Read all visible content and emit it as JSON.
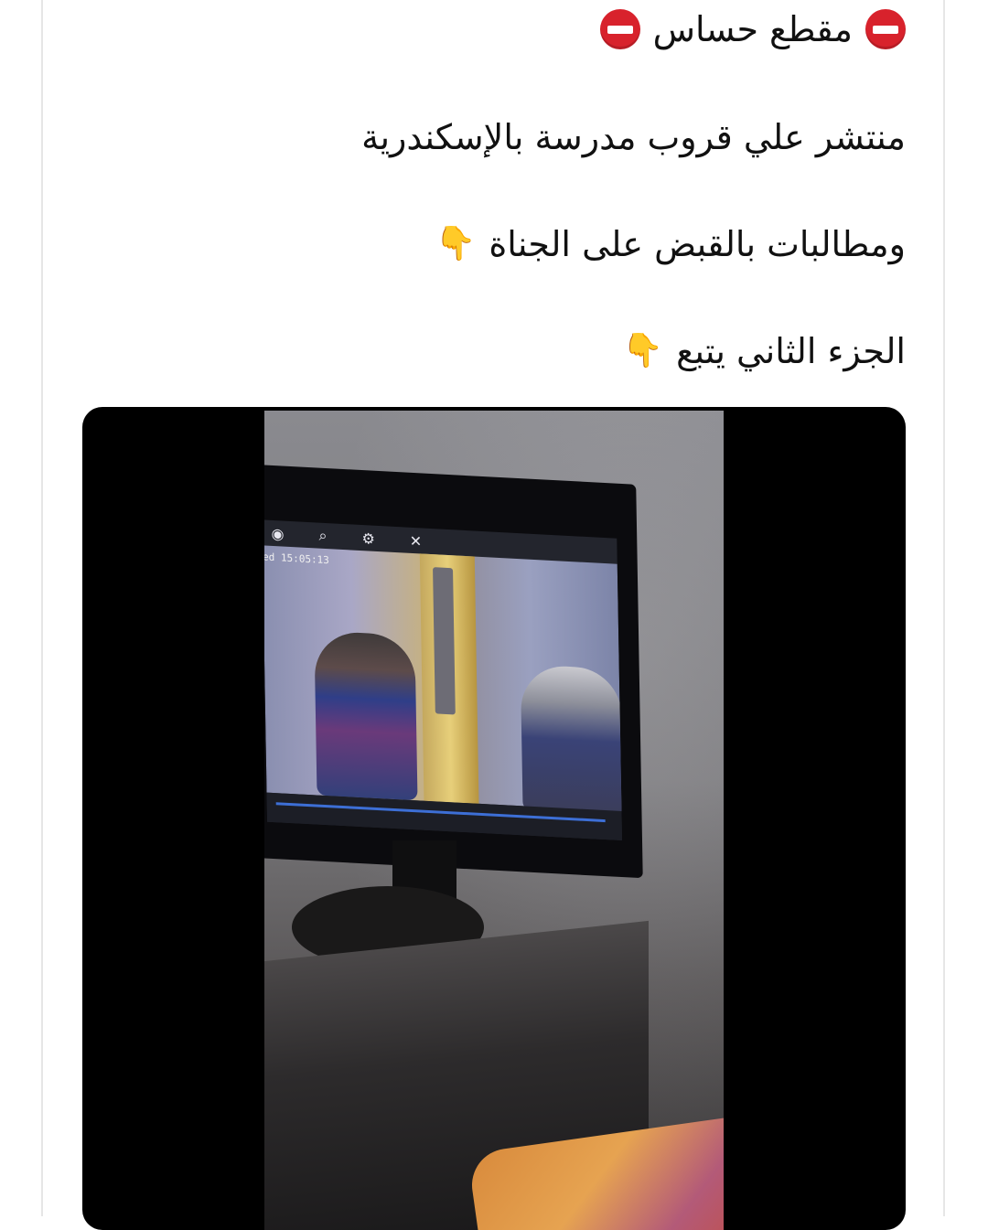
{
  "post": {
    "lines": [
      {
        "text": "مقطع حساس",
        "icons": [
          "no-entry-icon",
          "no-entry-icon"
        ]
      },
      {
        "text": "منتشر علي قروب مدرسة بالإسكندرية"
      },
      {
        "text": "ومطالبات بالقبض على الجناة",
        "icons": [
          "pointing-down-icon"
        ]
      },
      {
        "text": "الجزء الثاني يتبع",
        "icons": [
          "pointing-down-icon"
        ]
      }
    ]
  },
  "video": {
    "screen_timestamp": "ed 15:05:13"
  },
  "colors": {
    "no_entry_red": "#d8222c",
    "text": "#111111",
    "media_background": "#000000"
  }
}
